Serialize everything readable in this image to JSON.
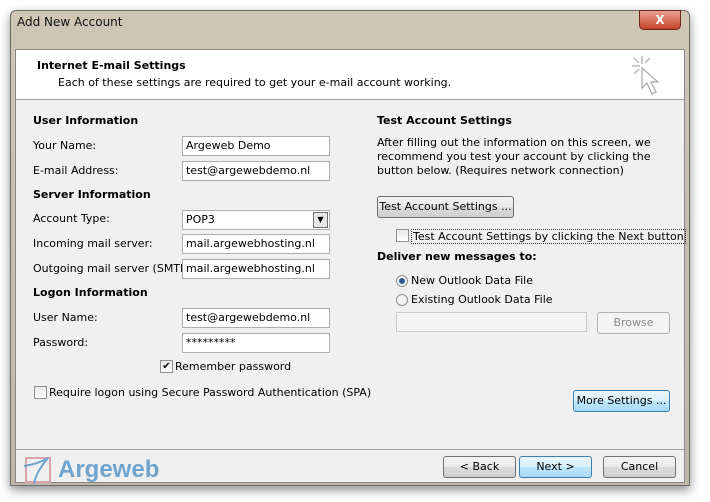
{
  "window": {
    "title": "Add New Account",
    "close": "X"
  },
  "header": {
    "title": "Internet E-mail Settings",
    "subtitle": "Each of these settings are required to get your e-mail account working."
  },
  "user_info": {
    "heading": "User Information",
    "name_label": "Your Name:",
    "name_value": "Argeweb Demo",
    "email_label": "E-mail Address:",
    "email_value": "test@argewebdemo.nl"
  },
  "server_info": {
    "heading": "Server Information",
    "account_type_label": "Account Type:",
    "account_type_value": "POP3",
    "incoming_label": "Incoming mail server:",
    "incoming_value": "mail.argewebhosting.nl",
    "outgoing_label": "Outgoing mail server (SMTP):",
    "outgoing_value": "mail.argewebhosting.nl"
  },
  "logon_info": {
    "heading": "Logon Information",
    "username_label": "User Name:",
    "username_value": "test@argewebdemo.nl",
    "password_label": "Password:",
    "password_value": "*********",
    "remember_label": "Remember password",
    "remember_checked": true,
    "spa_label": "Require logon using Secure Password Authentication (SPA)",
    "spa_checked": false
  },
  "test": {
    "heading": "Test Account Settings",
    "description": "After filling out the information on this screen, we recommend you test your account by clicking the button below. (Requires network connection)",
    "button": "Test Account Settings ...",
    "next_checkbox_label": "Test Account Settings by clicking the Next button",
    "next_checked": false
  },
  "deliver": {
    "heading": "Deliver new messages to:",
    "option_new": "New Outlook Data File",
    "option_existing": "Existing Outlook Data File",
    "selected": "New Outlook Data File",
    "existing_path": "",
    "browse": "Browse"
  },
  "more_settings": "More Settings ...",
  "footer": {
    "back": "< Back",
    "next": "Next >",
    "cancel": "Cancel",
    "logo_text": "Argeweb"
  }
}
